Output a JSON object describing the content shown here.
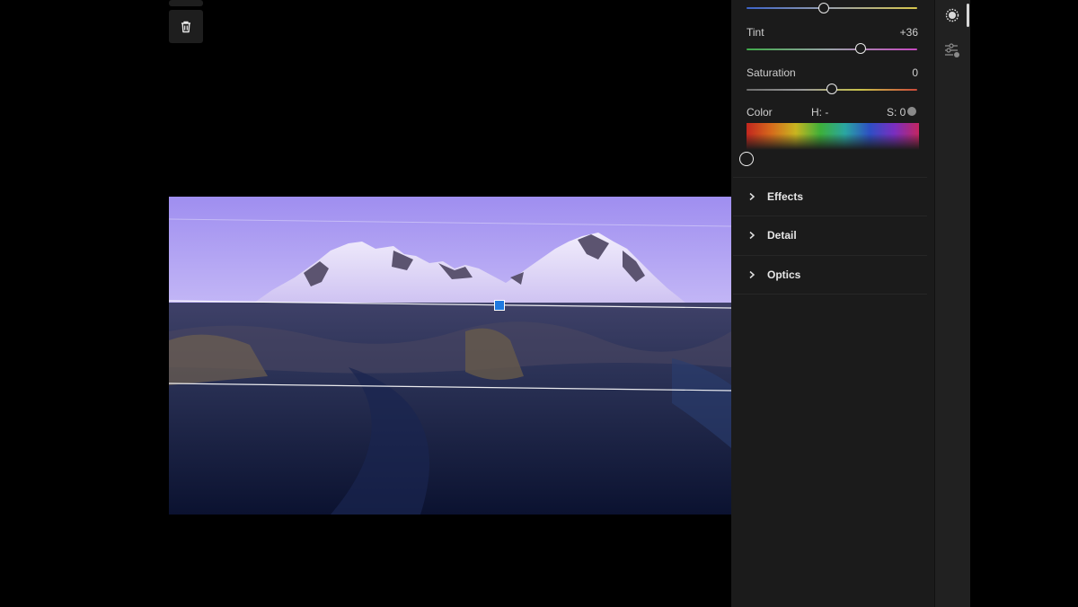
{
  "toolbar": {
    "delete_icon": "trash-icon"
  },
  "panel": {
    "tint": {
      "label": "Tint",
      "value": "+36",
      "level": 0.67
    },
    "saturation": {
      "label": "Saturation",
      "value": "0",
      "level": 0.5
    },
    "temp": {
      "level": 0.45
    },
    "color": {
      "label": "Color",
      "h_label": "H: -",
      "s_label": "S: 0"
    },
    "sections": [
      {
        "label": "Effects"
      },
      {
        "label": "Detail"
      },
      {
        "label": "Optics"
      }
    ]
  },
  "iconbar": {
    "items": [
      "color-mix-icon",
      "adjust-presets-icon"
    ]
  },
  "colors": {
    "mask_handle": "#1f7ae0",
    "panel_bg": "#1b1b1b"
  }
}
